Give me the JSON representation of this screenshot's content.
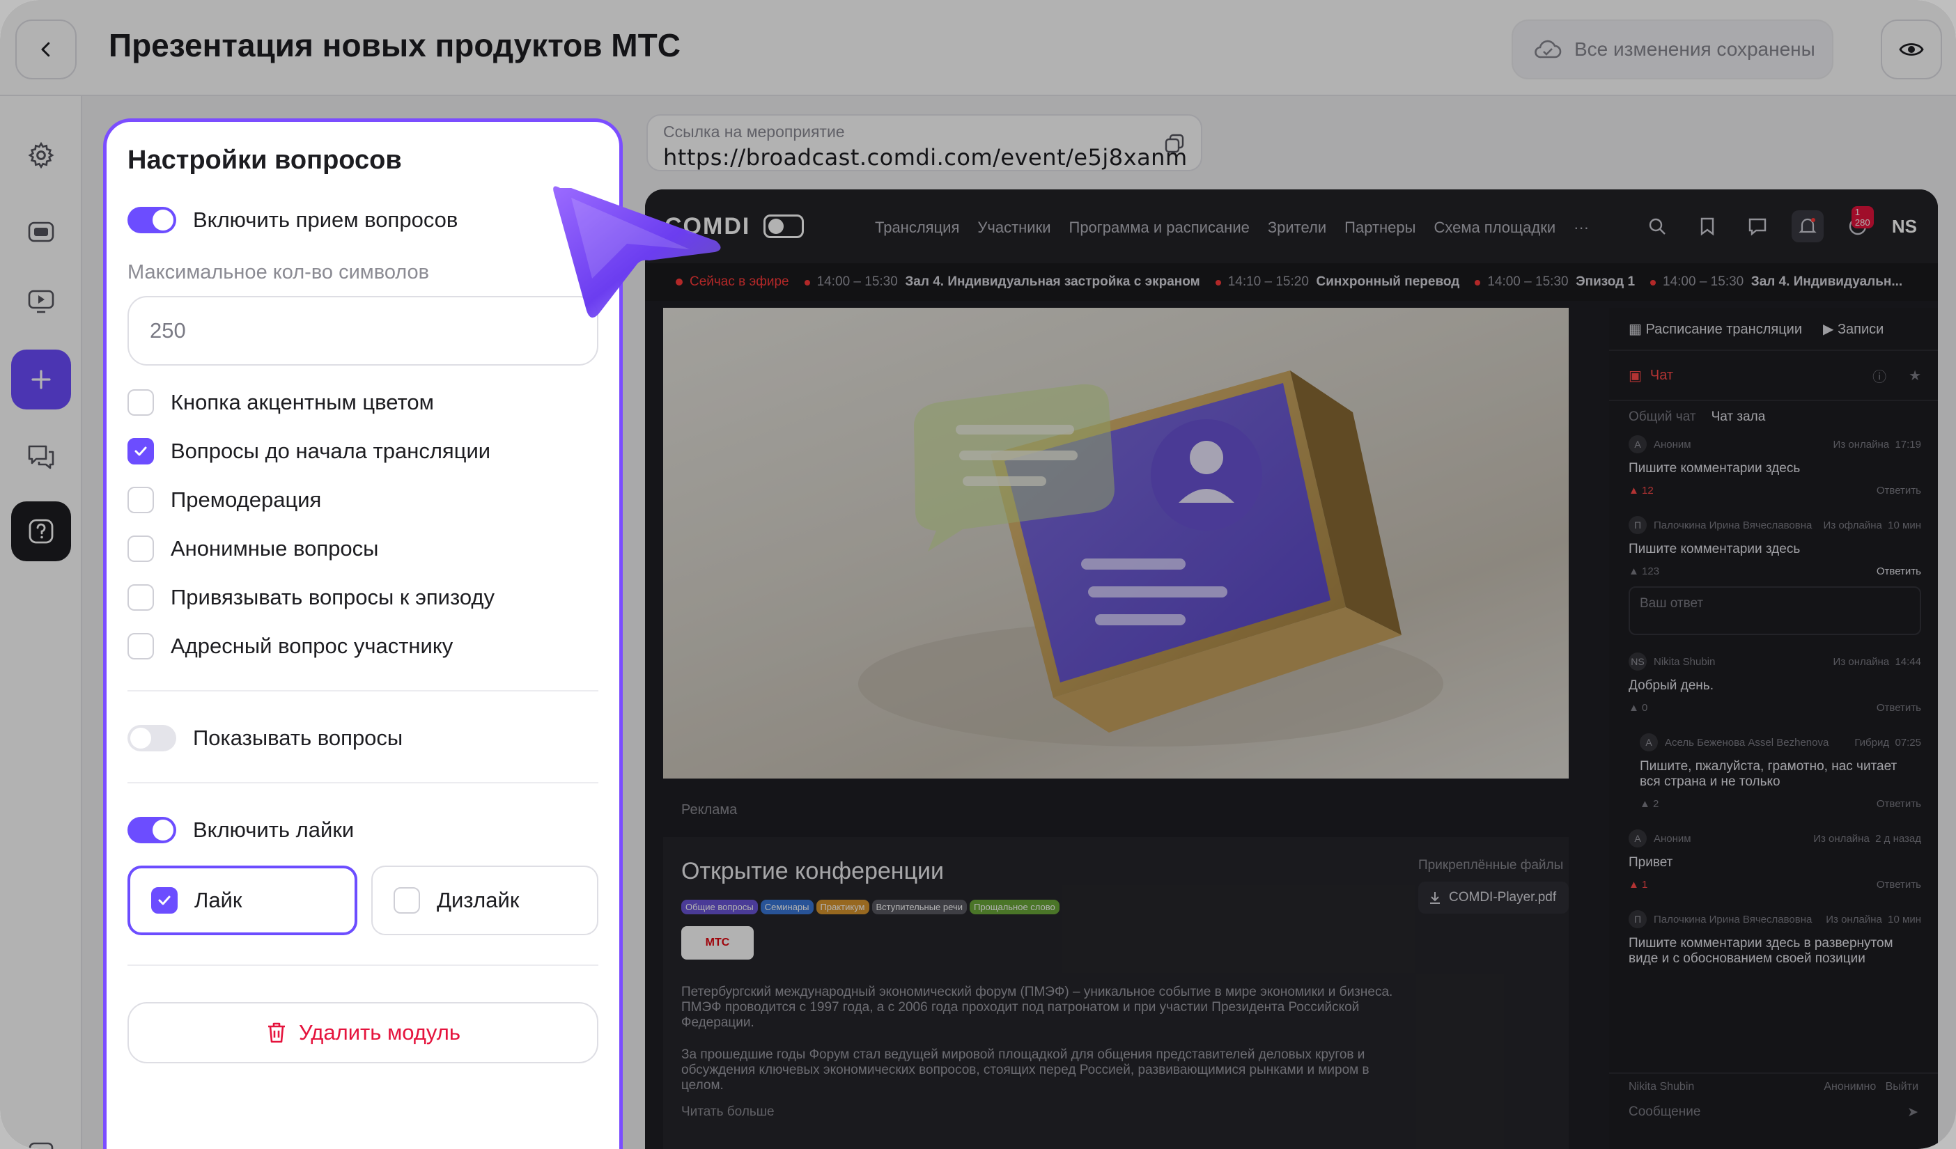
{
  "header": {
    "title": "Презентация новых продуктов МТС",
    "save_status": "Все изменения сохранены"
  },
  "event_link": {
    "label": "Ссылка на мероприятие",
    "url": "https://broadcast.comdi.com/event/e5j8xanm"
  },
  "settings_panel": {
    "title": "Настройки вопросов",
    "enable_questions": {
      "label": "Включить прием вопросов",
      "on": true
    },
    "max_chars": {
      "label": "Максимальное кол-во символов",
      "placeholder": "250"
    },
    "options": [
      {
        "label": "Кнопка акцентным цветом",
        "checked": false
      },
      {
        "label": "Вопросы до начала трансляции",
        "checked": true
      },
      {
        "label": "Премодерация",
        "checked": false
      },
      {
        "label": "Анонимные вопросы",
        "checked": false
      },
      {
        "label": "Привязывать вопросы к эпизоду",
        "checked": false
      },
      {
        "label": "Адресный вопрос участнику",
        "checked": false
      }
    ],
    "show_questions": {
      "label": "Показывать вопросы",
      "on": false
    },
    "enable_likes": {
      "label": "Включить лайки",
      "on": true
    },
    "like_choice": {
      "label": "Лайк",
      "checked": true
    },
    "dislike_choice": {
      "label": "Дизлайк",
      "checked": false
    },
    "delete_button": "Удалить модуль"
  },
  "player": {
    "logo": "COMDI",
    "nav": [
      "Трансляция",
      "Участники",
      "Программа и расписание",
      "Зрители",
      "Партнеры",
      "Схема площадки",
      "···"
    ],
    "notifications_badge": "1 280",
    "user_initials": "NS",
    "ticker": {
      "live": "Сейчас в эфире",
      "items": [
        {
          "time": "14:00 – 15:30",
          "title": "Зал 4. Индивидуальная застройка с экраном"
        },
        {
          "time": "14:10 – 15:20",
          "title": "Синхронный перевод"
        },
        {
          "time": "14:00 – 15:30",
          "title": "Эпизод 1"
        },
        {
          "time": "14:00 – 15:30",
          "title": "Зал 4. Индивидуальн..."
        }
      ]
    },
    "ad_label": "Реклама",
    "info": {
      "title": "Открытие конференции",
      "tags": [
        "Общие вопросы",
        "Семинары",
        "Практикум",
        "Вступительные речи",
        "Прощальное слово"
      ],
      "sponsor": "МТС",
      "paragraph1": "Петербургский международный экономический форум (ПМЭФ) – уникальное событие в мире экономики и бизнеса. ПМЭФ проводится с 1997 года, а с 2006 года проходит под патронатом и при участии Президента Российской Федерации.",
      "paragraph2": "За прошедшие годы Форум стал ведущей мировой площадкой для общения представителей деловых кругов и обсуждения ключевых экономических вопросов, стоящих перед Россией, развивающимися рынками и миром в целом.",
      "read_more": "Читать больше",
      "files_label": "Прикреплённые файлы",
      "file_name": "COMDI-Player.pdf"
    },
    "side": {
      "tab_schedule": "Расписание трансляции",
      "tab_records": "Записи",
      "chat_title": "Чат",
      "chat_general": "Общий чат",
      "chat_hall": "Чат зала",
      "reply_label": "Ответить",
      "reply_placeholder": "Ваш ответ",
      "messages": [
        {
          "avatar": "A",
          "author": "Аноним",
          "status": "Из онлайна",
          "time": "17:19",
          "text": "Пишите комментарии здесь",
          "likes": "12",
          "reply": false
        },
        {
          "avatar": "П",
          "author": "Палочкина Ирина Вячеславовна",
          "status": "Из офлайна",
          "time": "10 мин",
          "text": "Пишите комментарии здесь",
          "likes": "123",
          "reply": false
        },
        {
          "avatar": "NS",
          "author": "Nikita Shubin",
          "status": "Из онлайна",
          "time": "14:44",
          "text": "Добрый день.",
          "likes": "0",
          "reply": false
        },
        {
          "avatar": "А",
          "author": "Асель Беженова Assel Bezhenova",
          "status": "Гибрид",
          "time": "07:25",
          "text": "Пишите, пжалуйста, грамотно, нас читает вся страна и не только",
          "likes": "2",
          "reply": true
        },
        {
          "avatar": "A",
          "author": "Аноним",
          "status": "Из онлайна",
          "time": "2 д назад",
          "text": "Привет",
          "likes": "1",
          "reply": false
        },
        {
          "avatar": "П",
          "author": "Палочкина Ирина Вячеславовна",
          "status": "Из онлайна",
          "time": "10 мин",
          "text": "Пишите комментарии здесь в развернутом виде и с обоснованием своей позиции",
          "likes": "",
          "reply": false
        }
      ],
      "composer_user": "Nikita Shubin",
      "composer_anon": "Анонимно",
      "composer_exit": "Выйти",
      "composer_placeholder": "Сообщение"
    }
  }
}
